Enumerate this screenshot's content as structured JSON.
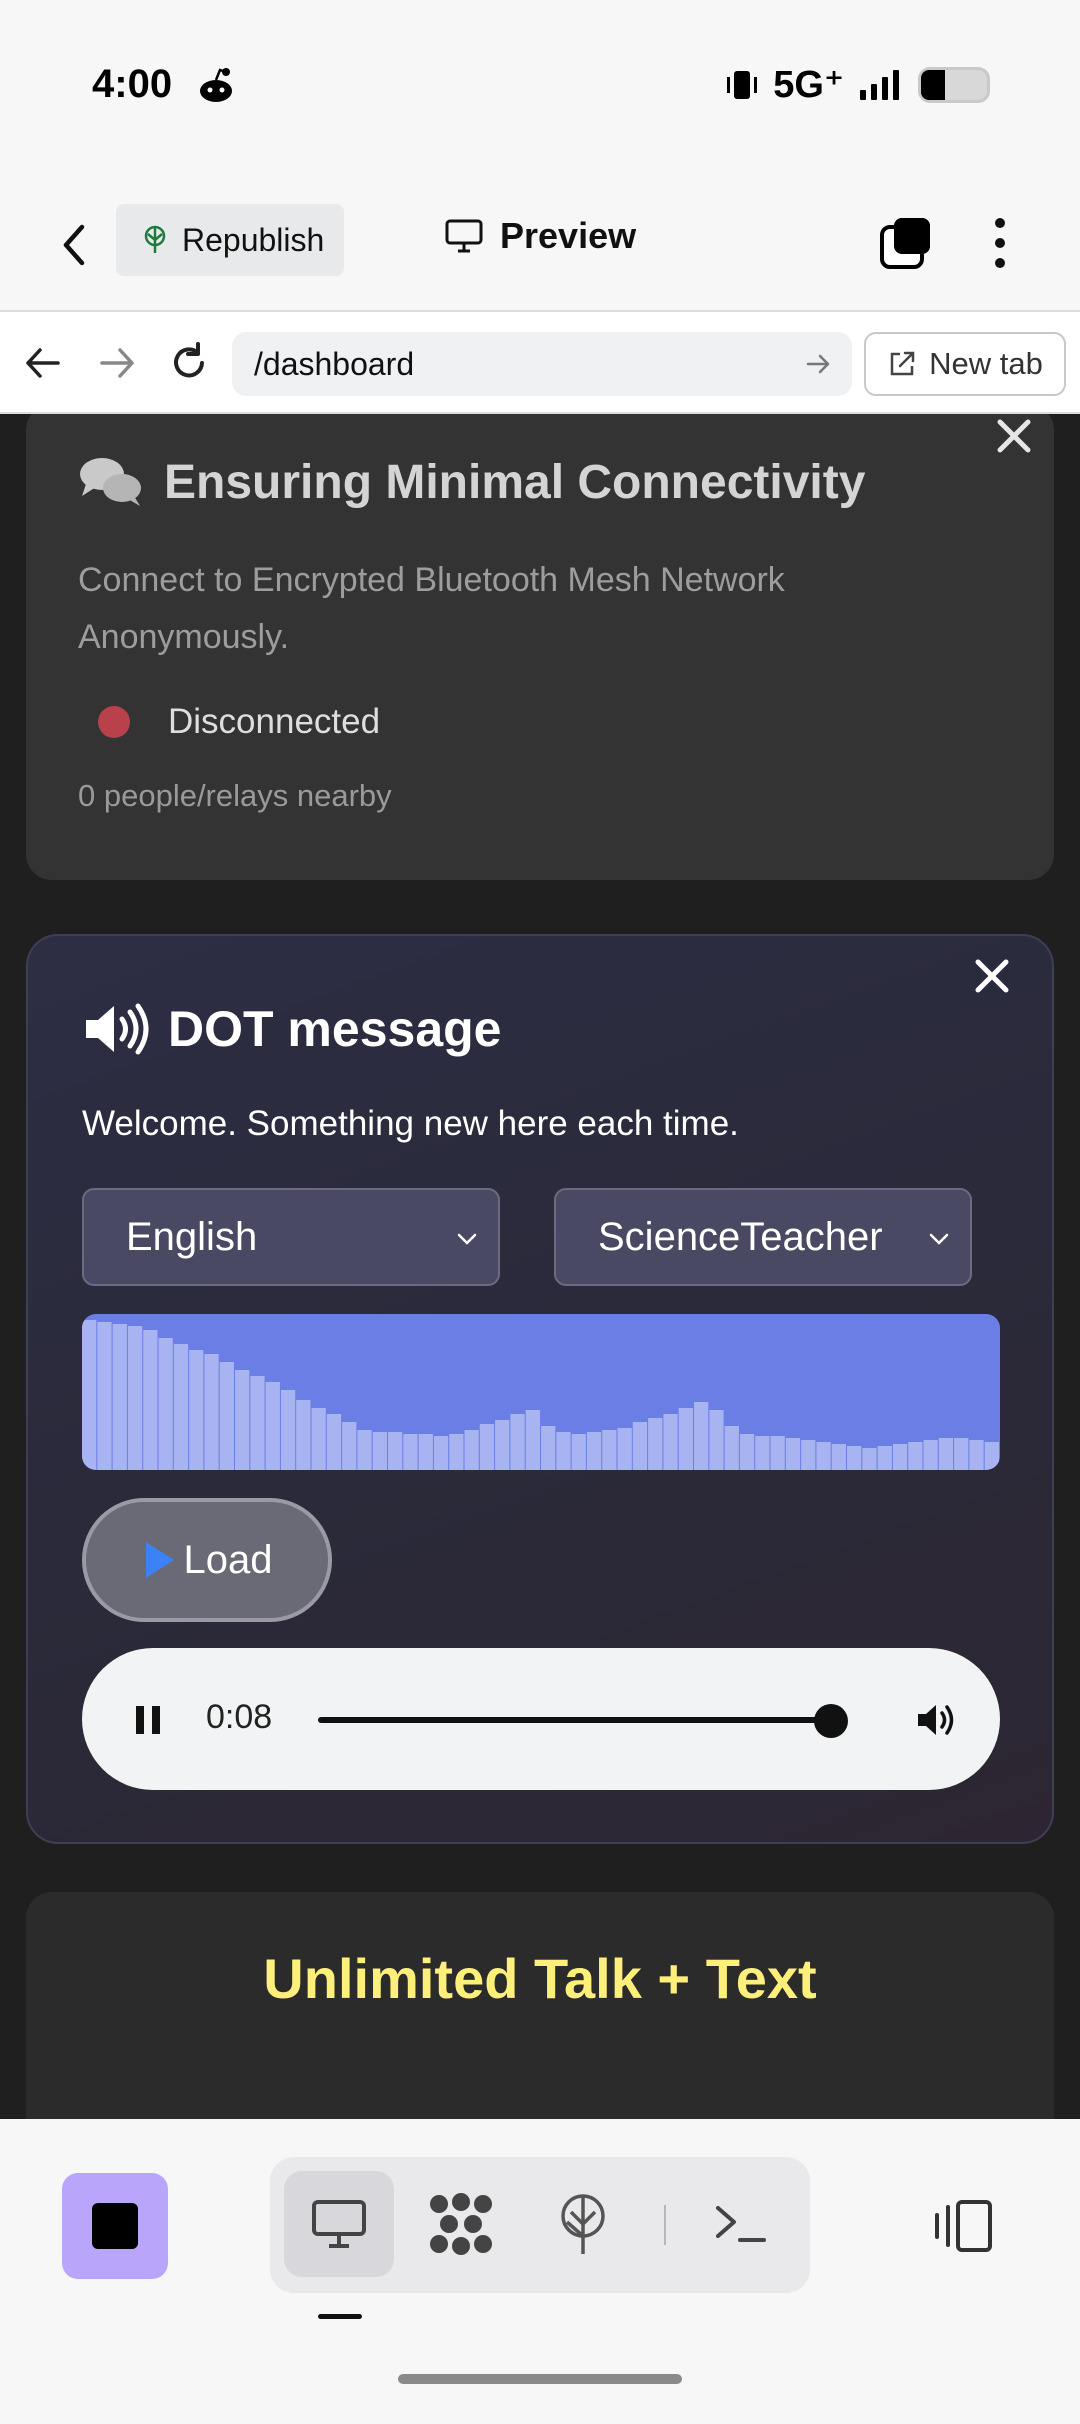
{
  "status_bar": {
    "time": "4:00",
    "network": "5G⁺",
    "battery_level": 0.36
  },
  "toolbar": {
    "republish_label": "Republish",
    "preview_label": "Preview"
  },
  "browser": {
    "url": "/dashboard",
    "new_tab_label": "New tab"
  },
  "connectivity_card": {
    "title": "Ensuring Minimal Connectivity",
    "description": "Connect to Encrypted Bluetooth Mesh Network Anonymously.",
    "status": "Disconnected",
    "status_color": "#b8414b",
    "nearby": "0 people/relays nearby"
  },
  "dot_card": {
    "title": "DOT message",
    "subtitle": "Welcome. Something new here each time.",
    "language_selected": "English",
    "voice_selected": "ScienceTeacher",
    "load_label": "Load",
    "player": {
      "time": "0:08",
      "progress": 0.97
    },
    "waveform_color": "#6a7ee6"
  },
  "promo_card": {
    "title": "Unlimited Talk + Text",
    "title_color": "#fdf07a"
  },
  "colors": {
    "accent": "#b9a6fb",
    "content_bg": "#1f1f1f"
  }
}
